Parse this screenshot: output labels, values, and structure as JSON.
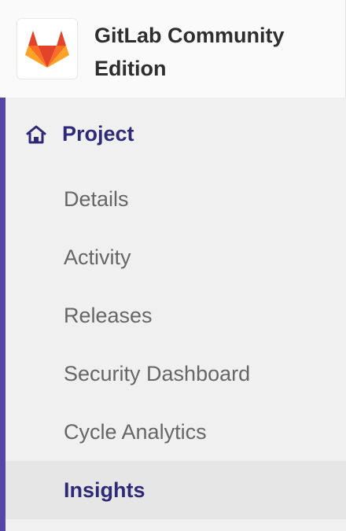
{
  "app": {
    "title": "GitLab Community Edition",
    "logo_icon": "gitlab-tanuki-icon"
  },
  "sidebar": {
    "section": {
      "icon": "home-icon",
      "label": "Project"
    },
    "items": [
      {
        "label": "Details",
        "active": false
      },
      {
        "label": "Activity",
        "active": false
      },
      {
        "label": "Releases",
        "active": false
      },
      {
        "label": "Security Dashboard",
        "active": false
      },
      {
        "label": "Cycle Analytics",
        "active": false
      },
      {
        "label": "Insights",
        "active": true
      }
    ]
  },
  "colors": {
    "accent": "#5446a6",
    "active_text": "#2e2a78",
    "inactive_text": "#666666",
    "active_bg": "#e6e6e6",
    "logo_orange": "#fc6d26",
    "logo_red": "#e24329",
    "logo_light": "#fca326"
  }
}
